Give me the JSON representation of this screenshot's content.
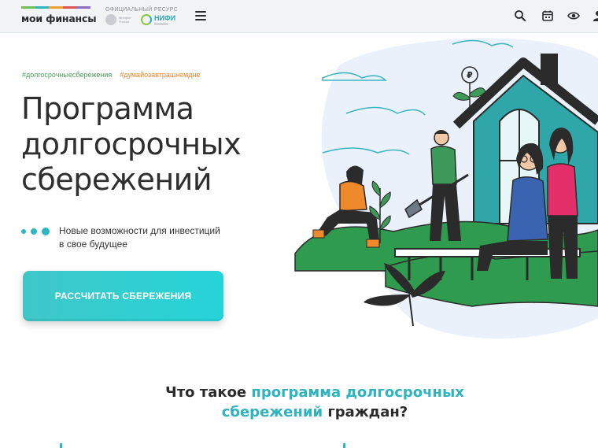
{
  "header": {
    "logo_text": "мои финансы",
    "official_label": "ОФИЦИАЛЬНЫЙ РЕСУРС",
    "minfin_text": "Минфин России",
    "nifi_name": "НИФИ",
    "icons": [
      "menu-icon",
      "search-icon",
      "calendar-icon",
      "eye-icon",
      "user-icon"
    ]
  },
  "hero": {
    "hashtag_1": "#долгосрочныесбережения",
    "hashtag_2": "#думайозавтрашнемдне",
    "title_line_1": "Программа",
    "title_line_2": "долгосрочных",
    "title_line_3": "сбережений",
    "subtitle_line_1": "Новые возможности для инвестиций",
    "subtitle_line_2": "в свое будущее",
    "cta_label": "РАССЧИТАТЬ СБЕРЕЖЕНИЯ",
    "coin_symbol": "₽"
  },
  "section": {
    "title_part_1": "Что такое ",
    "title_accent_1": "программа долгосрочных",
    "title_accent_2": "сбережений",
    "title_part_2": " граждан?"
  },
  "colors": {
    "accent": "#2db4bf",
    "hashtag_green": "#4aa35a",
    "hashtag_orange": "#e8842a",
    "button": "#2dcfd2"
  }
}
